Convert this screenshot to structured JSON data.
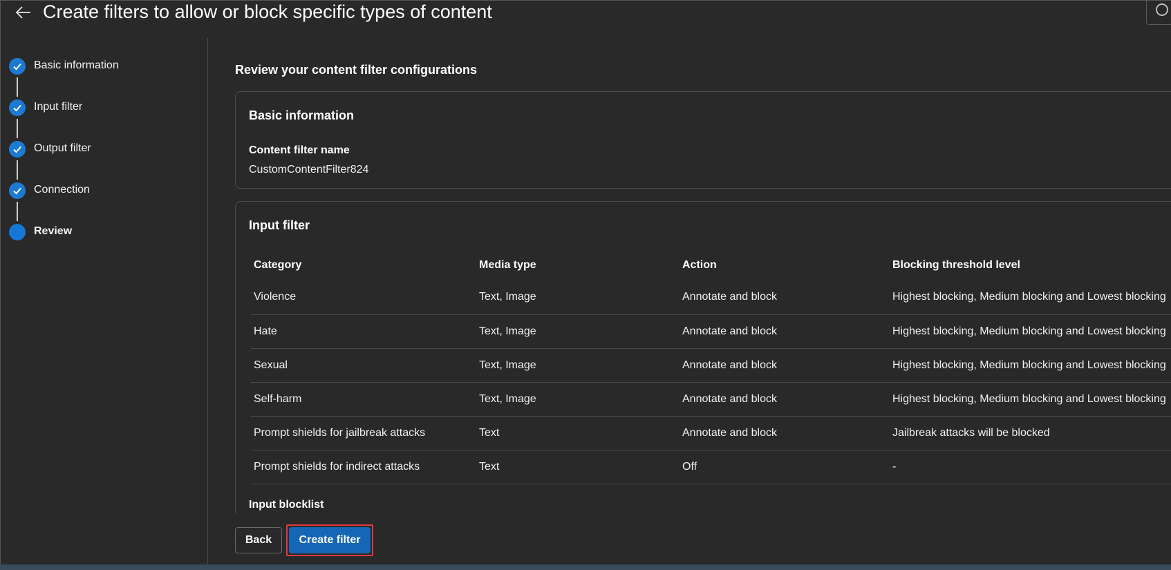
{
  "header": {
    "title": "Create filters to allow or block specific types of content"
  },
  "stepper": {
    "steps": [
      {
        "label": "Basic information",
        "status": "completed"
      },
      {
        "label": "Input filter",
        "status": "completed"
      },
      {
        "label": "Output filter",
        "status": "completed"
      },
      {
        "label": "Connection",
        "status": "completed"
      },
      {
        "label": "Review",
        "status": "current"
      }
    ]
  },
  "review": {
    "heading": "Review your content filter configurations",
    "basic_info": {
      "title": "Basic information",
      "name_label": "Content filter name",
      "name_value": "CustomContentFilter824"
    },
    "input_filter": {
      "title": "Input filter",
      "columns": [
        "Category",
        "Media type",
        "Action",
        "Blocking threshold level"
      ],
      "rows": [
        [
          "Violence",
          "Text, Image",
          "Annotate and block",
          "Highest blocking, Medium blocking and Lowest blocking"
        ],
        [
          "Hate",
          "Text, Image",
          "Annotate and block",
          "Highest blocking, Medium blocking and Lowest blocking"
        ],
        [
          "Sexual",
          "Text, Image",
          "Annotate and block",
          "Highest blocking, Medium blocking and Lowest blocking"
        ],
        [
          "Self-harm",
          "Text, Image",
          "Annotate and block",
          "Highest blocking, Medium blocking and Lowest blocking"
        ],
        [
          "Prompt shields for jailbreak attacks",
          "Text",
          "Annotate and block",
          "Jailbreak attacks will be blocked"
        ],
        [
          "Prompt shields for indirect attacks",
          "Text",
          "Off",
          "-"
        ]
      ],
      "blocklist_label": "Input blocklist"
    }
  },
  "footer": {
    "back_label": "Back",
    "create_label": "Create filter"
  },
  "colors": {
    "background": "#292929",
    "accent": "#1566b5",
    "step_complete": "#1c7ad2",
    "highlight": "#e0393e"
  }
}
